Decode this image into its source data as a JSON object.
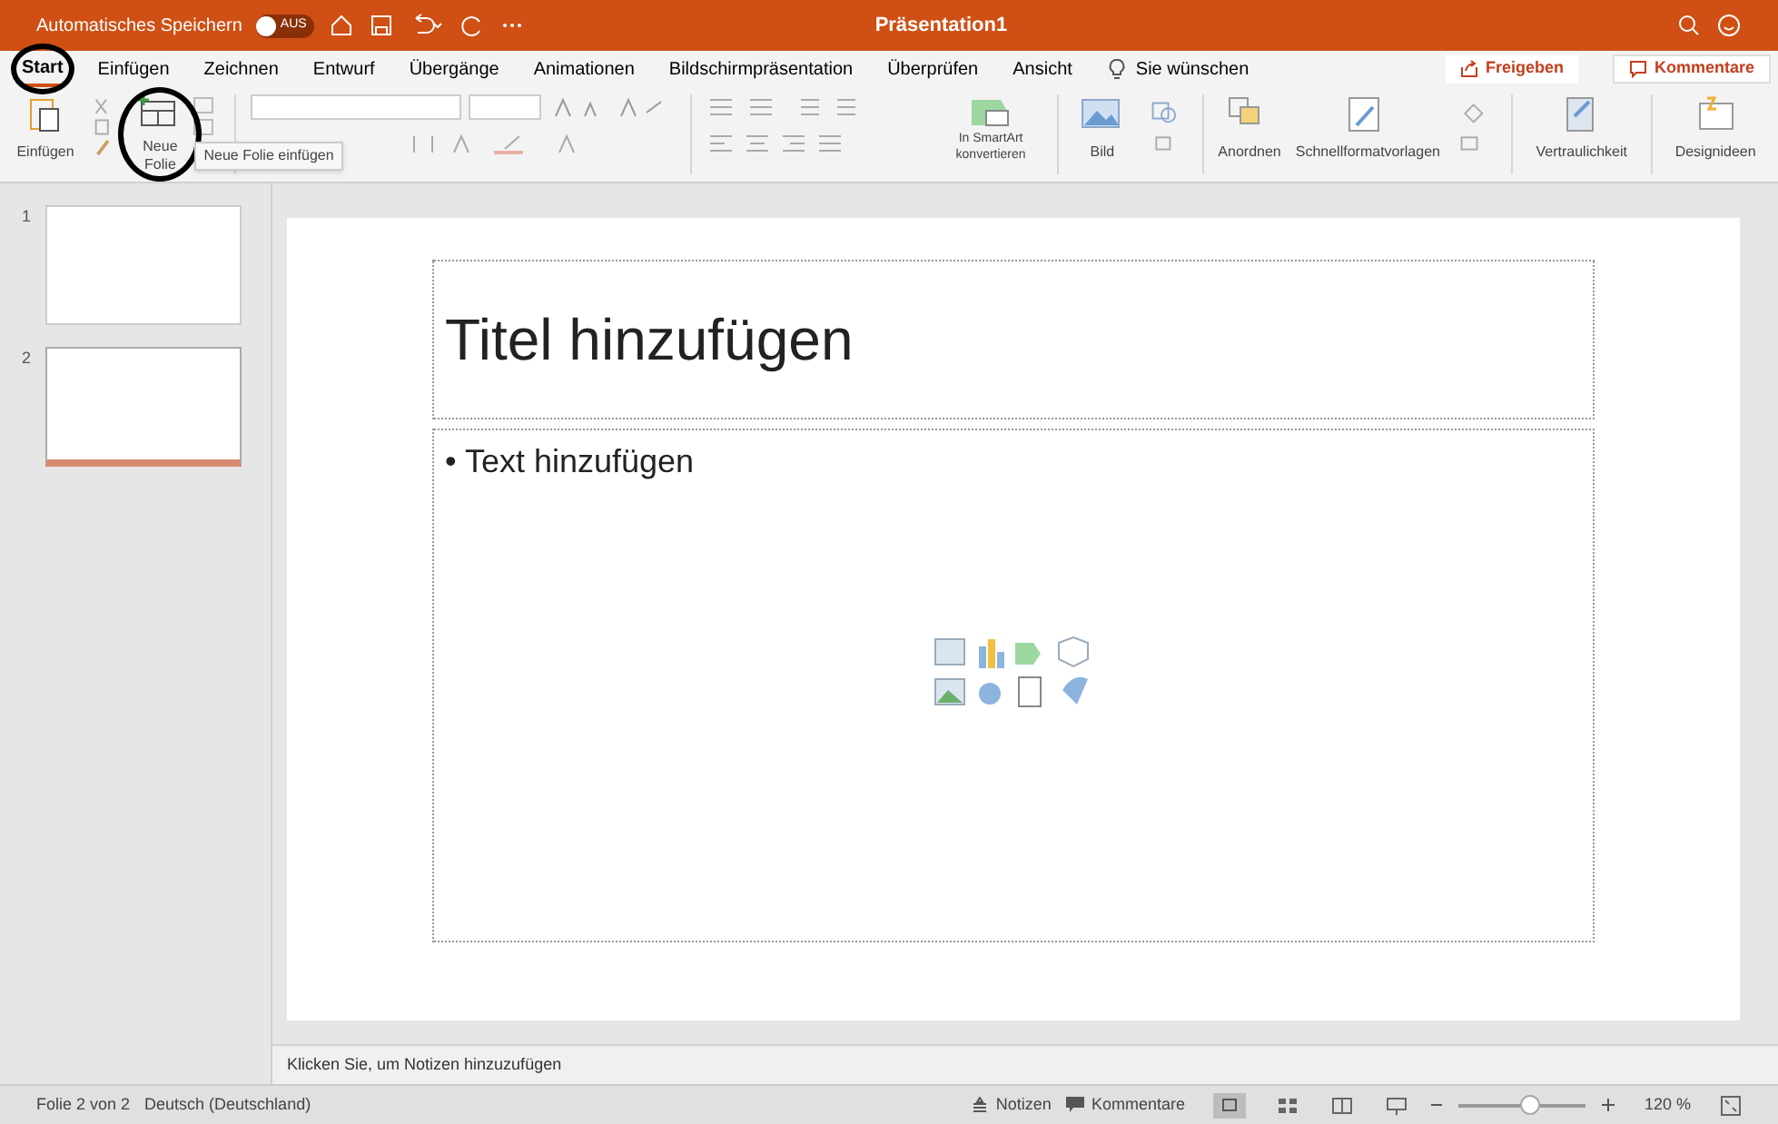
{
  "titlebar": {
    "autosave_label": "Automatisches Speichern",
    "autosave_state": "AUS",
    "autosave_on": false,
    "title": "Präsentation1"
  },
  "tabs": [
    {
      "label": "Start",
      "selected": true,
      "circled": true
    },
    {
      "label": "Einfügen",
      "selected": false,
      "circled": false
    },
    {
      "label": "Zeichnen",
      "selected": false,
      "circled": false
    },
    {
      "label": "Entwurf",
      "selected": false,
      "circled": false
    },
    {
      "label": "Übergänge",
      "selected": false,
      "circled": false
    },
    {
      "label": "Animationen",
      "selected": false,
      "circled": false
    },
    {
      "label": "Bildschirmpräsentation",
      "selected": false,
      "circled": false
    },
    {
      "label": "Überprüfen",
      "selected": false,
      "circled": false
    },
    {
      "label": "Ansicht",
      "selected": false,
      "circled": false
    }
  ],
  "tell_me": "Sie wünschen",
  "share_button": "Freigeben",
  "comments_button": "Kommentare",
  "ribbon": {
    "paste": "Einfügen",
    "new_slide": "Neue Folie",
    "new_slide_circled": true,
    "tooltip": "Neue Folie einfügen",
    "smartart": "In SmartArt konvertieren",
    "picture": "Bild",
    "arrange": "Anordnen",
    "quick_styles": "Schnellformatvorlagen",
    "sensitivity": "Vertraulichkeit",
    "designer": "Designideen"
  },
  "thumbnails": [
    {
      "number": "1",
      "selected": false
    },
    {
      "number": "2",
      "selected": true
    }
  ],
  "slide": {
    "title_placeholder": "Titel hinzufügen",
    "body_placeholder": "• Text hinzufügen"
  },
  "notes_placeholder": "Klicken Sie, um Notizen hinzuzufügen",
  "status_bar": {
    "slide_info": "Folie 2 von 2",
    "language": "Deutsch (Deutschland)",
    "notes": "Notizen",
    "comments": "Kommentare",
    "zoom": {
      "level": 0.55
    },
    "zoom_value": "120 %"
  }
}
